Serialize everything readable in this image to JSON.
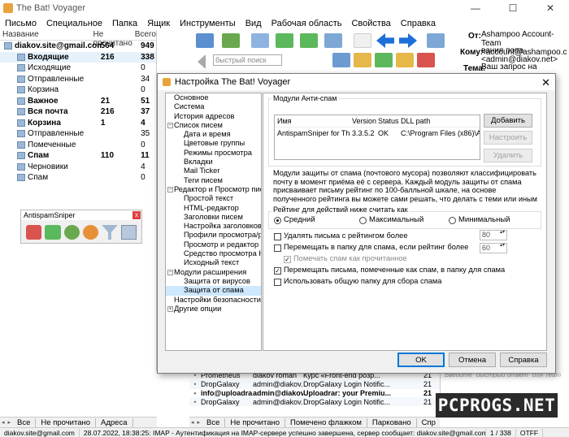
{
  "window": {
    "title": "The Bat! Voyager",
    "min": "—",
    "max": "☐",
    "close": "✕"
  },
  "menu": [
    "Письмо",
    "Специальное",
    "Папка",
    "Ящик",
    "Инструменты",
    "Вид",
    "Рабочая область",
    "Свойства",
    "Справка"
  ],
  "folders": {
    "headers": {
      "name": "Название",
      "unread": "Не прочитано",
      "total": "Всего"
    },
    "rows": [
      {
        "name": "diakov.site@gmail.com",
        "unread": "564",
        "total": "949",
        "level": 0,
        "bold": true
      },
      {
        "name": "Входящие",
        "unread": "216",
        "total": "338",
        "level": 1,
        "bold": true,
        "sel": true
      },
      {
        "name": "Исходящие",
        "unread": "",
        "total": "0",
        "level": 1,
        "bold": false
      },
      {
        "name": "Отправленные",
        "unread": "",
        "total": "34",
        "level": 1,
        "bold": false
      },
      {
        "name": "Корзина",
        "unread": "",
        "total": "0",
        "level": 1,
        "bold": false
      },
      {
        "name": "Важное",
        "unread": "21",
        "total": "51",
        "level": 1,
        "bold": true
      },
      {
        "name": "Вся почта",
        "unread": "216",
        "total": "37",
        "level": 1,
        "bold": true
      },
      {
        "name": "Корзина",
        "unread": "1",
        "total": "4",
        "level": 1,
        "bold": true
      },
      {
        "name": "Отправленные",
        "unread": "",
        "total": "35",
        "level": 1,
        "bold": false
      },
      {
        "name": "Помеченные",
        "unread": "",
        "total": "0",
        "level": 1,
        "bold": false
      },
      {
        "name": "Спам",
        "unread": "110",
        "total": "11",
        "level": 1,
        "bold": true
      },
      {
        "name": "Черновики",
        "unread": "",
        "total": "4",
        "level": 1,
        "bold": false
      },
      {
        "name": "Спам",
        "unread": "",
        "total": "0",
        "level": 1,
        "bold": false
      }
    ]
  },
  "toolbar": {
    "quick_search_placeholder": "быстрый поиск"
  },
  "header": {
    "from_label": "От:",
    "from_value": "Ashampoo Account-Team <account@ashampoo.com>",
    "to_label": "Кому:",
    "to_value": "вания попа <admin@diakov.net>",
    "subject_label": "Тема:",
    "subject_value": "Ваш запрос на изменение пароля"
  },
  "antisniper": {
    "title": "AntispamSniper",
    "close": "x"
  },
  "dialog": {
    "title": "Настройка The Bat! Voyager",
    "tree": [
      {
        "label": "Основное",
        "level": 1
      },
      {
        "label": "Система",
        "level": 1
      },
      {
        "label": "История адресов",
        "level": 1
      },
      {
        "label": "Список писем",
        "level": 1,
        "expander": "−"
      },
      {
        "label": "Дата и время",
        "level": 2
      },
      {
        "label": "Цветовые группы",
        "level": 2
      },
      {
        "label": "Режимы просмотра",
        "level": 2
      },
      {
        "label": "Вкладки",
        "level": 2
      },
      {
        "label": "Mail Ticker",
        "level": 2
      },
      {
        "label": "Теги писем",
        "level": 2
      },
      {
        "label": "Редактор и Просмотр писем",
        "level": 1,
        "expander": "−"
      },
      {
        "label": "Простой текст",
        "level": 2
      },
      {
        "label": "HTML-редактор",
        "level": 2
      },
      {
        "label": "Заголовки писем",
        "level": 2
      },
      {
        "label": "Настройка заголовков",
        "level": 2
      },
      {
        "label": "Профили просмотра/ред",
        "level": 2
      },
      {
        "label": "Просмотр и редактор пис",
        "level": 2
      },
      {
        "label": "Средство просмотра HTM",
        "level": 2
      },
      {
        "label": "Исходный текст",
        "level": 2
      },
      {
        "label": "Модули расширения",
        "level": 1,
        "expander": "−"
      },
      {
        "label": "Защита от вирусов",
        "level": 2
      },
      {
        "label": "Защита от спама",
        "level": 2,
        "sel": true
      },
      {
        "label": "Настройки безопасности прик",
        "level": 1
      },
      {
        "label": "Другие опции",
        "level": 1,
        "expander": "+"
      }
    ],
    "modules_group": "Модули Анти-спам",
    "table": {
      "headers": {
        "name": "Имя",
        "version": "Version",
        "status": "Status",
        "dll": "DLL path"
      },
      "row": {
        "name": "AntispamSniper for The ...",
        "version": "3.3.5.2",
        "status": "OK",
        "dll": "C:\\Program Files (x86)\\Antis"
      }
    },
    "buttons": {
      "add": "Добавить",
      "configure": "Настроить",
      "remove": "Удалить"
    },
    "description": "Модули защиты от спама (почтового мусора) позволяют классифицировать почту в момент приёма её с сервера. Каждый модуль защиты от спама присваивает письму рейтинг по 100-балльной шкале, на основе полученного рейтинга вы можете сами решать, что делать с теми или иным письмом...",
    "rating_group": "Рейтинг для действий ниже считать как",
    "radios": {
      "medium": "Средний",
      "max": "Максимальный",
      "min": "Минимальный"
    },
    "options": {
      "delete": "Удалять письма с рейтингом более",
      "delete_val": "80",
      "move": "Перемещать в папку для спама, если рейтинг более",
      "move_val": "60",
      "mark_read": "Помечать спам как прочитанное",
      "move_flagged": "Перемещать письма, помеченные как спам, в папку для спама",
      "common_folder": "Использовать общую папку для сбора спама"
    },
    "footer": {
      "ok": "OK",
      "cancel": "Отмена",
      "help": "Справка"
    }
  },
  "messages": [
    {
      "from": "Prometheus",
      "to": "diakov roman",
      "subject": "Курс «Front-end розр...",
      "date": "21",
      "bold": false
    },
    {
      "from": "DropGalaxy",
      "to": "admin@diakov.n...",
      "subject": "DropGalaxy Login Notific...",
      "date": "21",
      "bold": false
    },
    {
      "from": "info@uploadra...",
      "to": "admin@diakov.n...",
      "subject": "Uploadrar: your Premiu...",
      "date": "21",
      "bold": true
    },
    {
      "from": "DropGalaxy",
      "to": "admin@diakov.n...",
      "subject": "DropGalaxy Login Notific...",
      "date": "21",
      "bold": false
    }
  ],
  "reply_hint": "Введите \"быстрый ответ\" для Team",
  "tabs_left": [
    "Все",
    "Не прочитано",
    "Адреса"
  ],
  "tabs_right": [
    "Все",
    "Не прочитано",
    "Помечено флажком",
    "Парковано",
    "Спр"
  ],
  "status": {
    "account": "diakov.site@gmail.com",
    "time": "28.07.2022, 18:38:25: IMAP - Аутентификация на IMAP-сервере успешно завершена, сервер сообщает: diakov.site@gmail.com authenticated (Success)",
    "count": "1 / 338",
    "otf": "OTFF"
  },
  "watermark": "PCPROGS.NET"
}
